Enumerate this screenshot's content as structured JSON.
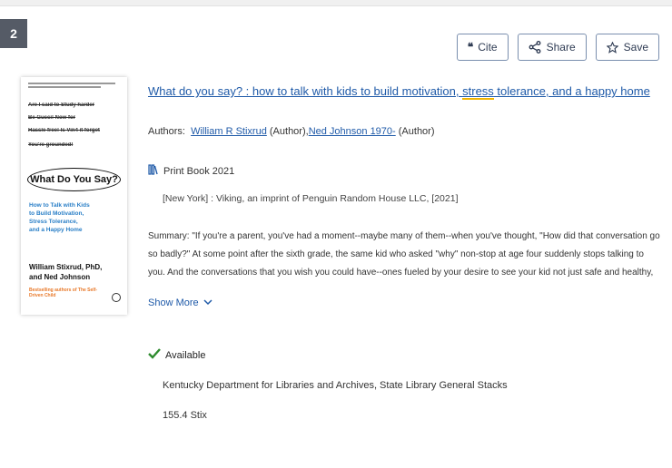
{
  "result": {
    "number": "2"
  },
  "actions": {
    "cite": "Cite",
    "share": "Share",
    "save": "Save"
  },
  "cover": {
    "top_text": "Stop saying everything you're saying",
    "struck_lines": [
      "Are I said to Study harder",
      "Be Gucci! Now for",
      "Hassle free! Is Vin4 it forget",
      "You're grounded!"
    ],
    "title": "What Do You Say?",
    "subtitle": [
      "How to Talk with Kids",
      "to Build Motivation,",
      "Stress Tolerance,",
      "and a Happy Home"
    ],
    "authors": [
      "William Stixrud, PhD,",
      "and Ned Johnson"
    ],
    "tagline": "Bestselling authors of The Self-Driven Child"
  },
  "title": {
    "before": "What do you say? : how to talk with kids to build motivation, ",
    "highlight": "stress",
    "after": " tolerance, and a happy home"
  },
  "authors": {
    "label": "Authors:",
    "author1": "William R Stixrud",
    "role1": "(Author),",
    "author2": "Ned Johnson 1970-",
    "role2": "(Author)"
  },
  "format": {
    "label": "Print Book 2021",
    "icon": "book-icon"
  },
  "publication": "[New York] : Viking, an imprint of Penguin Random House LLC, [2021]",
  "summary": {
    "label": "Summary:",
    "text": "\"If you're a parent, you've had a moment--maybe many of them--when you've thought, \"How did that conversation go so badly?\" At some point after the sixth grade, the same kid who asked \"why\" non-stop at age four suddenly stops talking to you. And the conversations that you wish you could have--ones fueled by your desire to see your kid not just safe and healthy, but"
  },
  "show_more": "Show More",
  "availability": {
    "status": "Available",
    "status_color": "#2e8b2e",
    "location": "Kentucky Department for Libraries and Archives, State Library General Stacks",
    "call_number": "155.4 Stix"
  },
  "colors": {
    "link": "#1f5aa8",
    "badge_bg": "#555b66",
    "highlight": "#f0b400"
  }
}
